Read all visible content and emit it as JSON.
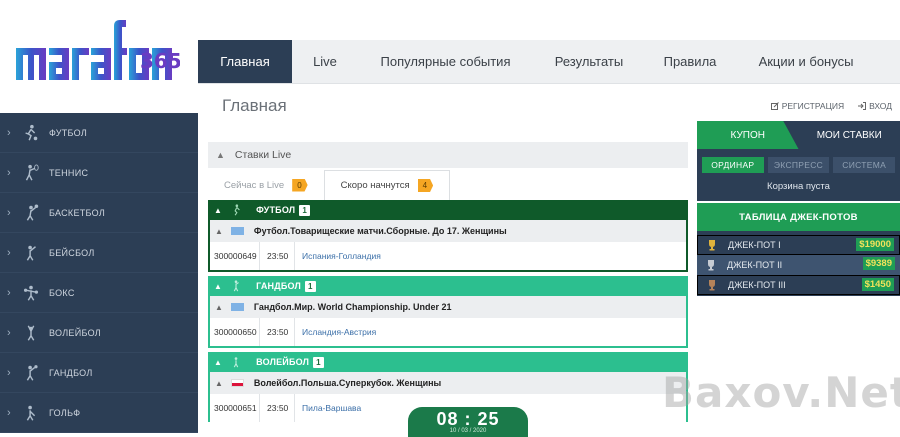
{
  "brand": {
    "logo_text": "marafon 365"
  },
  "topnav": {
    "items": [
      {
        "label": "Главная",
        "active": true
      },
      {
        "label": "Live"
      },
      {
        "label": "Популярные события"
      },
      {
        "label": "Результаты"
      },
      {
        "label": "Правила"
      },
      {
        "label": "Акции и бонусы"
      }
    ]
  },
  "page": {
    "title": "Главная",
    "register_label": "РЕГИСТРАЦИЯ",
    "login_label": "ВХОД"
  },
  "sidebar": {
    "items": [
      {
        "label": "ФУТБОЛ",
        "icon": "football-icon"
      },
      {
        "label": "ТЕННИС",
        "icon": "tennis-icon"
      },
      {
        "label": "БАСКЕТБОЛ",
        "icon": "basketball-icon"
      },
      {
        "label": "БЕЙСБОЛ",
        "icon": "baseball-icon"
      },
      {
        "label": "БОКС",
        "icon": "boxing-icon"
      },
      {
        "label": "ВОЛЕЙБОЛ",
        "icon": "volleyball-icon"
      },
      {
        "label": "ГАНДБОЛ",
        "icon": "handball-icon"
      },
      {
        "label": "ГОЛЬФ",
        "icon": "golf-icon"
      }
    ]
  },
  "live": {
    "panel_title": "Ставки Live",
    "tab_now": "Сейчас в Live",
    "tab_now_count": "0",
    "tab_soon": "Скоро начнутся",
    "tab_soon_count": "4"
  },
  "sports": [
    {
      "name": "ФУТБОЛ",
      "count": "1",
      "league": "Футбол.Товарищеские матчи.Сборные. До 17. Женщины",
      "event": {
        "id": "300000649",
        "time": "23:50",
        "teams": "Испания-Голландия"
      }
    },
    {
      "name": "ГАНДБОЛ",
      "count": "1",
      "league": "Гандбол.Мир. World Championship. Under 21",
      "event": {
        "id": "300000650",
        "time": "23:50",
        "teams": "Исландия-Австрия"
      }
    },
    {
      "name": "ВОЛЕЙБОЛ",
      "count": "1",
      "league": "Волейбол.Польша.Суперкубок. Женщины",
      "event": {
        "id": "300000651",
        "time": "23:50",
        "teams": "Пила-Варшава"
      }
    }
  ],
  "clock": {
    "time": "08 : 25",
    "date": "10 / 03 / 2020"
  },
  "coupon": {
    "tab_coupon": "КУПОН",
    "tab_my_bets": "МОИ СТАВКИ",
    "types": [
      "ОРДИНАР",
      "ЭКСПРЕСС",
      "СИСТЕМА"
    ],
    "empty_text": "Корзина пуста"
  },
  "jackpots": {
    "title": "ТАБЛИЦА ДЖЕК-ПОТОВ",
    "rows": [
      {
        "label": "ДЖЕК-ПОТ I",
        "amount": "$19000"
      },
      {
        "label": "ДЖЕК-ПОТ II",
        "amount": "$9389"
      },
      {
        "label": "ДЖЕК-ПОТ III",
        "amount": "$1450"
      }
    ]
  },
  "watermark": "Baxov.Net",
  "colors": {
    "navy": "#2c3e55",
    "green": "#1f9d55",
    "dark_green": "#0f5a2a",
    "teal": "#2cbf8f",
    "accent_orange": "#f5a623"
  }
}
